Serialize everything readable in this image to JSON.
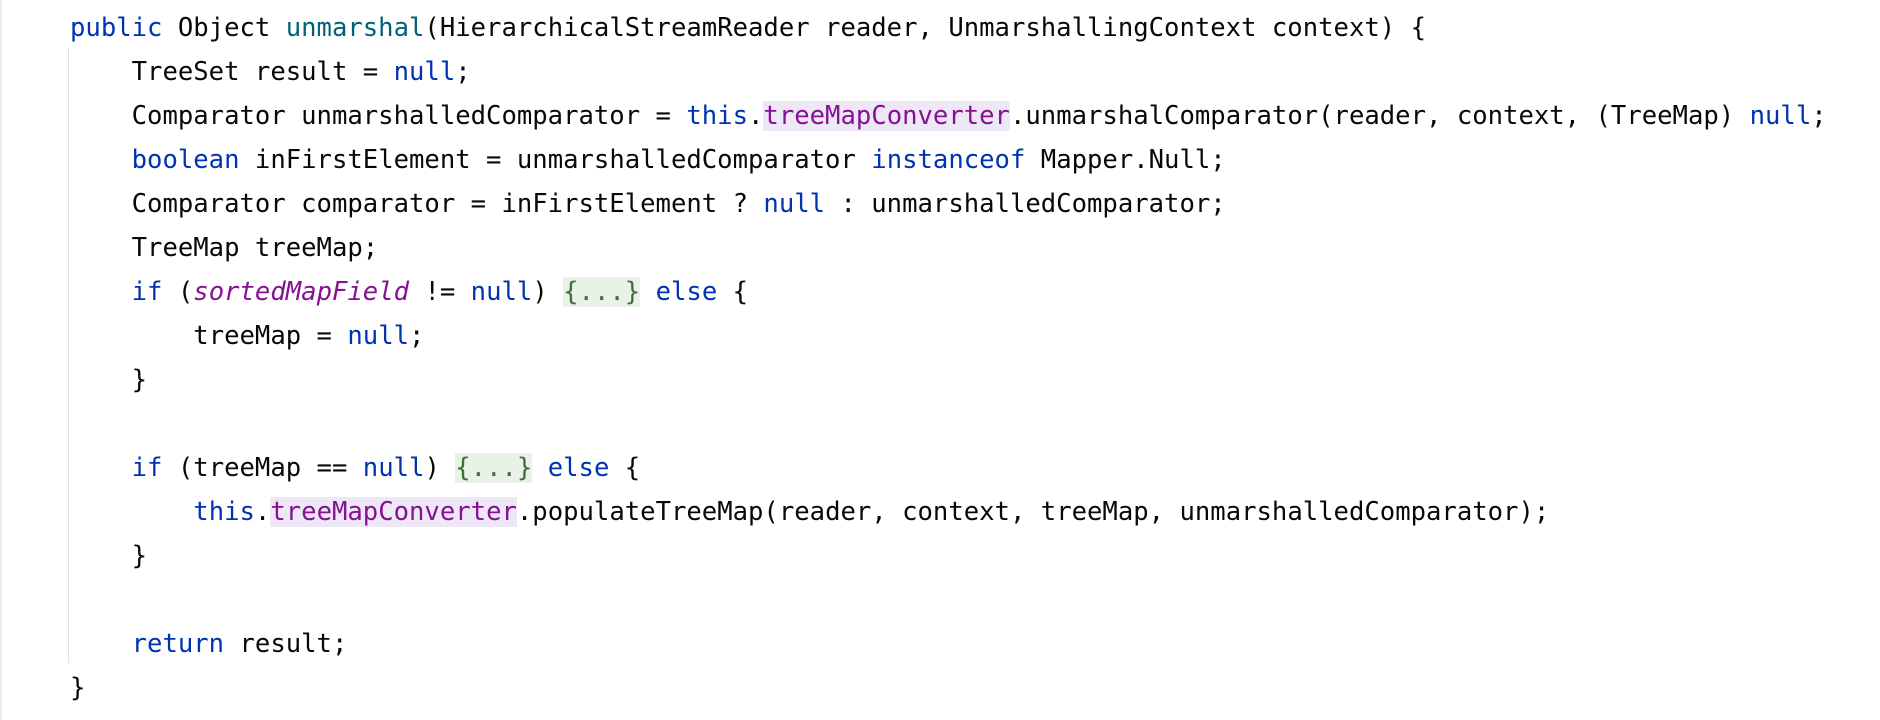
{
  "editor": {
    "language": "java",
    "lines": [
      {
        "indent": "",
        "tokens": [
          {
            "t": "public",
            "c": "kw"
          },
          {
            "t": " Object "
          },
          {
            "t": "unmarshal",
            "c": "fn"
          },
          {
            "t": "(HierarchicalStreamReader reader, UnmarshallingContext context) {"
          }
        ]
      },
      {
        "indent": "    ",
        "tokens": [
          {
            "t": "TreeSet result = "
          },
          {
            "t": "null",
            "c": "kw"
          },
          {
            "t": ";"
          }
        ]
      },
      {
        "indent": "    ",
        "tokens": [
          {
            "t": "Comparator unmarshalledComparator = "
          },
          {
            "t": "this",
            "c": "kw"
          },
          {
            "t": "."
          },
          {
            "t": "treeMapConverter",
            "c": "field hl"
          },
          {
            "t": ".unmarshalComparator(reader, context, (TreeMap) "
          },
          {
            "t": "null",
            "c": "kw"
          },
          {
            "t": ";"
          }
        ]
      },
      {
        "indent": "    ",
        "tokens": [
          {
            "t": "boolean",
            "c": "kw"
          },
          {
            "t": " inFirstElement = unmarshalledComparator "
          },
          {
            "t": "instanceof",
            "c": "kw"
          },
          {
            "t": " Mapper.Null;"
          }
        ]
      },
      {
        "indent": "    ",
        "tokens": [
          {
            "t": "Comparator comparator = inFirstElement ? "
          },
          {
            "t": "null",
            "c": "kw"
          },
          {
            "t": " : unmarshalledComparator;"
          }
        ]
      },
      {
        "indent": "    ",
        "tokens": [
          {
            "t": "TreeMap treeMap;"
          }
        ]
      },
      {
        "indent": "    ",
        "tokens": [
          {
            "t": "if",
            "c": "kw"
          },
          {
            "t": " ("
          },
          {
            "t": "sortedMapField",
            "c": "field-i"
          },
          {
            "t": " != "
          },
          {
            "t": "null",
            "c": "kw"
          },
          {
            "t": ") "
          },
          {
            "t": "{...}",
            "c": "fold",
            "fold": true
          },
          {
            "t": " "
          },
          {
            "t": "else",
            "c": "kw"
          },
          {
            "t": " {"
          }
        ]
      },
      {
        "indent": "        ",
        "tokens": [
          {
            "t": "treeMap = "
          },
          {
            "t": "null",
            "c": "kw"
          },
          {
            "t": ";"
          }
        ]
      },
      {
        "indent": "    ",
        "tokens": [
          {
            "t": "}"
          }
        ]
      },
      {
        "indent": "",
        "tokens": []
      },
      {
        "indent": "    ",
        "tokens": [
          {
            "t": "if",
            "c": "kw"
          },
          {
            "t": " (treeMap == "
          },
          {
            "t": "null",
            "c": "kw"
          },
          {
            "t": ") "
          },
          {
            "t": "{...}",
            "c": "fold",
            "fold": true
          },
          {
            "t": " "
          },
          {
            "t": "else",
            "c": "kw"
          },
          {
            "t": " {"
          }
        ]
      },
      {
        "indent": "        ",
        "tokens": [
          {
            "t": "this",
            "c": "kw"
          },
          {
            "t": "."
          },
          {
            "t": "treeMapConverter",
            "c": "field hl"
          },
          {
            "t": ".populateTreeMap(reader, context, treeMap, unmarshalledComparator);"
          }
        ]
      },
      {
        "indent": "    ",
        "tokens": [
          {
            "t": "}"
          }
        ]
      },
      {
        "indent": "",
        "tokens": []
      },
      {
        "indent": "    ",
        "tokens": [
          {
            "t": "return",
            "c": "kw"
          },
          {
            "t": " result;"
          }
        ]
      },
      {
        "indent": "",
        "tokens": [
          {
            "t": "}"
          }
        ]
      }
    ]
  },
  "colors": {
    "keyword": "#0033b3",
    "method_declaration": "#00627a",
    "field": "#871094",
    "default_text": "#080808",
    "usage_highlight": "#ede7f6",
    "folded_region_bg": "#e8f2e6",
    "folded_region_text": "#3f6e3b",
    "background": "#ffffff"
  }
}
